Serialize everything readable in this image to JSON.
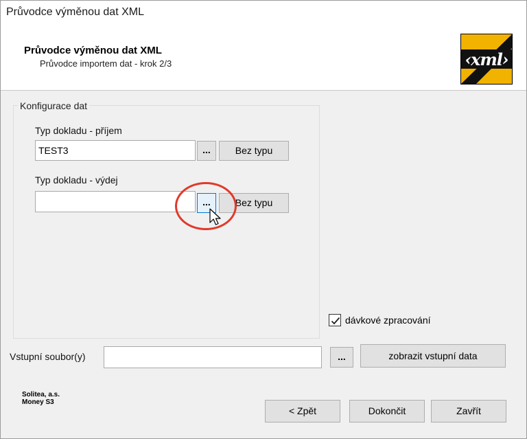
{
  "window": {
    "title": "Průvodce výměnou dat XML"
  },
  "header": {
    "title": "Průvodce výměnou dat XML",
    "subtitle": "Průvodce importem dat - krok 2/3",
    "logo_text": "‹xml›"
  },
  "config_group": {
    "legend": "Konfigurace dat",
    "receipt_label": "Typ dokladu - příjem",
    "receipt_value": "TEST3",
    "issue_label": "Typ dokladu - výdej",
    "issue_value": "",
    "browse_label": "...",
    "no_type_label": "Bez typu"
  },
  "batch": {
    "label": "dávkové zpracování",
    "checked": true
  },
  "input_file": {
    "label": "Vstupní soubor(y)",
    "value": "",
    "browse_label": "...",
    "show_data_label": "zobrazit vstupní data"
  },
  "company": {
    "line1": "Solitea, a.s.",
    "line2": "Money S3"
  },
  "footer": {
    "back_label": "< Zpět",
    "finish_label": "Dokončit",
    "close_label": "Zavřít"
  },
  "colors": {
    "annotation_circle": "#e03a2b",
    "hover_border": "#0078d7"
  }
}
